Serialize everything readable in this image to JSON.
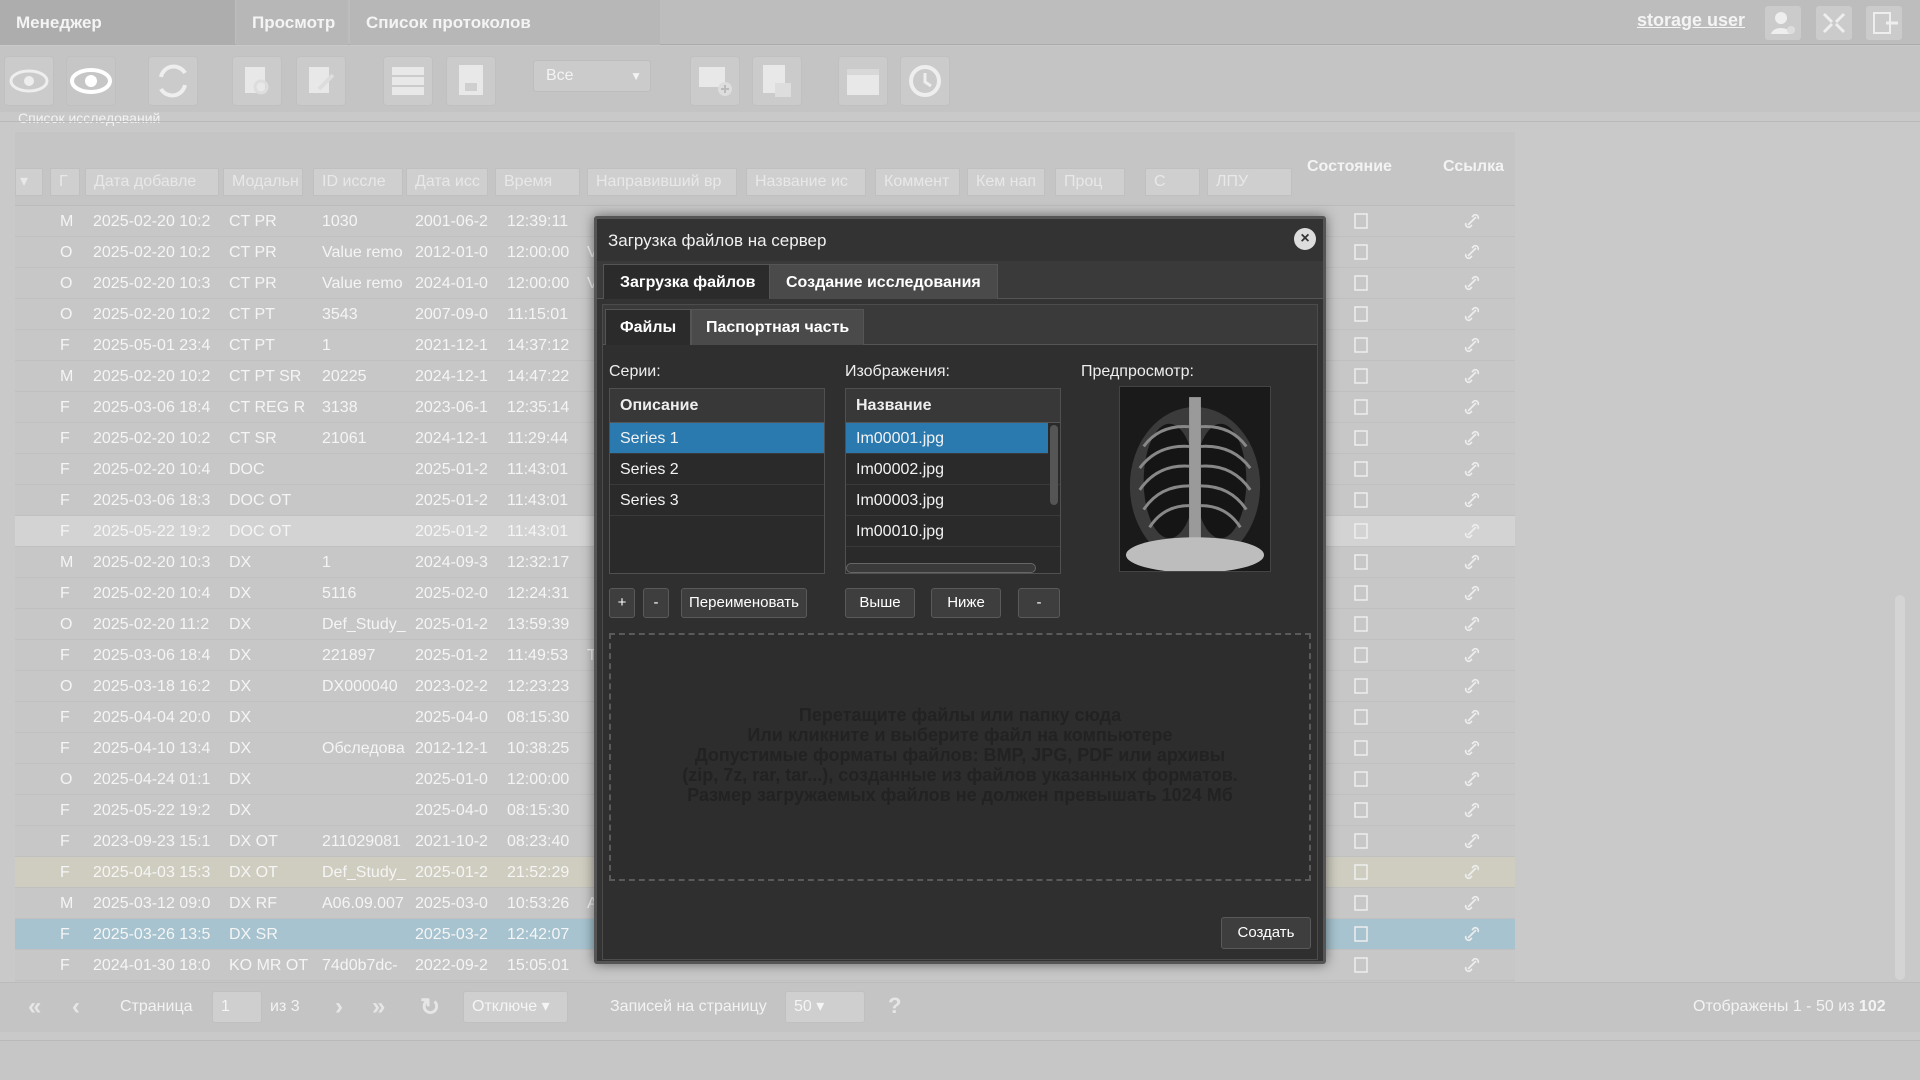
{
  "topbar": {
    "tabs": [
      {
        "label": "Менеджер исследований"
      },
      {
        "label": "Просмотр"
      },
      {
        "label": "Список протоколов исследований"
      }
    ],
    "user": "storage user"
  },
  "toolbar": {
    "filter_value": "Все"
  },
  "section_title": "Список исследований",
  "grid": {
    "headers": {
      "c1": "Г",
      "date_added": "Дата добавле",
      "modality": "Модальн",
      "study_id": "ID иссле",
      "study_date": "Дата исс",
      "time": "Время",
      "ref_doctor": "Направивший вр",
      "study_name": "Название ис",
      "comment": "Коммент",
      "sent_by": "Кем нап",
      "proc": "Проц",
      "c": "С",
      "lpu": "ЛПУ",
      "state": "Состояние",
      "link": "Ссылка"
    },
    "rows": [
      {
        "sex": "M",
        "date": "2025-02-20 10:2",
        "mod": "CT PR",
        "id": "1030",
        "sdate": "2001-06-2",
        "time": "12:39:11",
        "extra": ""
      },
      {
        "sex": "O",
        "date": "2025-02-20 10:2",
        "mod": "CT PR",
        "id": "Value remo",
        "sdate": "2012-01-0",
        "time": "12:00:00",
        "extra": "V"
      },
      {
        "sex": "O",
        "date": "2025-02-20 10:3",
        "mod": "CT PR",
        "id": "Value remo",
        "sdate": "2024-01-0",
        "time": "12:00:00",
        "extra": "V"
      },
      {
        "sex": "O",
        "date": "2025-02-20 10:2",
        "mod": "CT PT",
        "id": "3543",
        "sdate": "2007-09-0",
        "time": "11:15:01",
        "extra": ""
      },
      {
        "sex": "F",
        "date": "2025-05-01 23:4",
        "mod": "CT PT",
        "id": "1",
        "sdate": "2021-12-1",
        "time": "14:37:12",
        "extra": ""
      },
      {
        "sex": "M",
        "date": "2025-02-20 10:2",
        "mod": "CT PT SR",
        "id": "20225",
        "sdate": "2024-12-1",
        "time": "14:47:22",
        "extra": ""
      },
      {
        "sex": "F",
        "date": "2025-03-06 18:4",
        "mod": "CT REG R",
        "id": "3138",
        "sdate": "2023-06-1",
        "time": "12:35:14",
        "extra": ""
      },
      {
        "sex": "F",
        "date": "2025-02-20 10:2",
        "mod": "CT SR",
        "id": "21061",
        "sdate": "2024-12-1",
        "time": "11:29:44",
        "extra": ""
      },
      {
        "sex": "F",
        "date": "2025-02-20 10:4",
        "mod": "DOC",
        "id": "",
        "sdate": "2025-01-2",
        "time": "11:43:01",
        "extra": ""
      },
      {
        "sex": "F",
        "date": "2025-03-06 18:3",
        "mod": "DOC OT",
        "id": "",
        "sdate": "2025-01-2",
        "time": "11:43:01",
        "extra": ""
      },
      {
        "sex": "F",
        "date": "2025-05-22 19:2",
        "mod": "DOC OT",
        "id": "",
        "sdate": "2025-01-2",
        "time": "11:43:01",
        "extra": ""
      },
      {
        "sex": "M",
        "date": "2025-02-20 10:3",
        "mod": "DX",
        "id": "1",
        "sdate": "2024-09-3",
        "time": "12:32:17",
        "extra": ""
      },
      {
        "sex": "F",
        "date": "2025-02-20 10:4",
        "mod": "DX",
        "id": "5116",
        "sdate": "2025-02-0",
        "time": "12:24:31",
        "extra": ""
      },
      {
        "sex": "O",
        "date": "2025-02-20 11:2",
        "mod": "DX",
        "id": "Def_Study_",
        "sdate": "2025-01-2",
        "time": "13:59:39",
        "extra": ""
      },
      {
        "sex": "F",
        "date": "2025-03-06 18:4",
        "mod": "DX",
        "id": "221897",
        "sdate": "2025-01-2",
        "time": "11:49:53",
        "extra": "T"
      },
      {
        "sex": "O",
        "date": "2025-03-18 16:2",
        "mod": "DX",
        "id": "DX000040",
        "sdate": "2023-02-2",
        "time": "12:23:23",
        "extra": ""
      },
      {
        "sex": "F",
        "date": "2025-04-04 20:0",
        "mod": "DX",
        "id": "",
        "sdate": "2025-04-0",
        "time": "08:15:30",
        "extra": ""
      },
      {
        "sex": "F",
        "date": "2025-04-10 13:4",
        "mod": "DX",
        "id": "Обследова",
        "sdate": "2012-12-1",
        "time": "10:38:25",
        "extra": ""
      },
      {
        "sex": "O",
        "date": "2025-04-24 01:1",
        "mod": "DX",
        "id": "",
        "sdate": "2025-01-0",
        "time": "12:00:00",
        "extra": ""
      },
      {
        "sex": "F",
        "date": "2025-05-22 19:2",
        "mod": "DX",
        "id": "",
        "sdate": "2025-04-0",
        "time": "08:15:30",
        "extra": ""
      },
      {
        "sex": "F",
        "date": "2023-09-23 15:1",
        "mod": "DX OT",
        "id": "211029081",
        "sdate": "2021-10-2",
        "time": "08:23:40",
        "extra": ""
      },
      {
        "sex": "F",
        "date": "2025-04-03 15:3",
        "mod": "DX OT",
        "id": "Def_Study_",
        "sdate": "2025-01-2",
        "time": "21:52:29",
        "extra": ""
      },
      {
        "sex": "M",
        "date": "2025-03-12 09:0",
        "mod": "DX RF",
        "id": "A06.09.007",
        "sdate": "2025-03-0",
        "time": "10:53:26",
        "extra": "A"
      },
      {
        "sex": "F",
        "date": "2025-03-26 13:5",
        "mod": "DX SR",
        "id": "",
        "sdate": "2025-03-2",
        "time": "12:42:07",
        "extra": ""
      },
      {
        "sex": "F",
        "date": "2024-01-30 18:0",
        "mod": "KO MR OT",
        "id": "74d0b7dc-",
        "sdate": "2022-09-2",
        "time": "15:05:01",
        "extra": ""
      }
    ]
  },
  "pager": {
    "page_label": "Страница",
    "page_value": "1",
    "of_label": "из 3",
    "refresh_mode": "Отключе",
    "per_page_label": "Записей на страницу",
    "per_page_value": "50",
    "shown_label": "Отображены 1 - 50 из",
    "total": "102"
  },
  "modal": {
    "title": "Загрузка файлов на сервер",
    "tabs": [
      "Загрузка файлов",
      "Создание исследования"
    ],
    "inner_tabs": [
      "Файлы",
      "Паспортная часть"
    ],
    "series_label": "Серии:",
    "series_header": "Описание",
    "series": [
      "Series 1",
      "Series 2",
      "Series 3"
    ],
    "images_label": "Изображения:",
    "images_header": "Название",
    "images": [
      "Im00001.jpg",
      "Im00002.jpg",
      "Im00003.jpg",
      "Im00010.jpg"
    ],
    "preview_label": "Предпросмотр:",
    "btn_add": "+",
    "btn_remove": "-",
    "btn_rename": "Переименовать",
    "btn_up": "Выше",
    "btn_down": "Ниже",
    "btn_img_remove": "-",
    "drop_lines": [
      "Перетащите файлы или папку сюда",
      "Или кликните и выберите файл на компьютере",
      "Допустимые форматы файлов: BMP, JPG, PDF или архивы",
      "(zip, 7z, rar, tar...), созданные из файлов указанных форматов.",
      "Размер загружаемых файлов не должен превышать 1024 Мб"
    ],
    "create_btn": "Создать"
  }
}
